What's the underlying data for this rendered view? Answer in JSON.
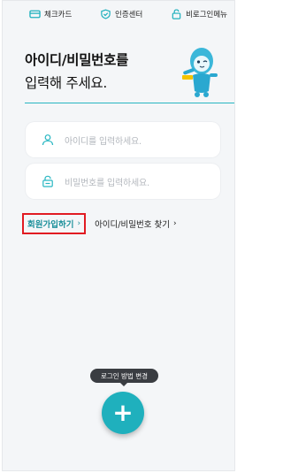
{
  "topbar": {
    "items": [
      {
        "label": "체크카드",
        "icon": "card-icon"
      },
      {
        "label": "인증센터",
        "icon": "shield-check-icon"
      },
      {
        "label": "비로그인메뉴",
        "icon": "unlock-icon"
      }
    ]
  },
  "heading": {
    "line1": "아이디/비밀번호를",
    "line2": "입력해 주세요."
  },
  "login_form": {
    "id_placeholder": "아이디를 입력하세요.",
    "password_placeholder": "비밀번호를 입력하세요."
  },
  "links": {
    "signup_label": "회원가입하기",
    "find_label": "아이디/비밀번호 찾기",
    "chevron": "›"
  },
  "fab": {
    "tooltip": "로그인 방법 변경",
    "symbol": "+"
  },
  "colors": {
    "accent": "#1fb0bd",
    "highlight_box": "#e11b22",
    "link_teal": "#1a8f9a"
  }
}
